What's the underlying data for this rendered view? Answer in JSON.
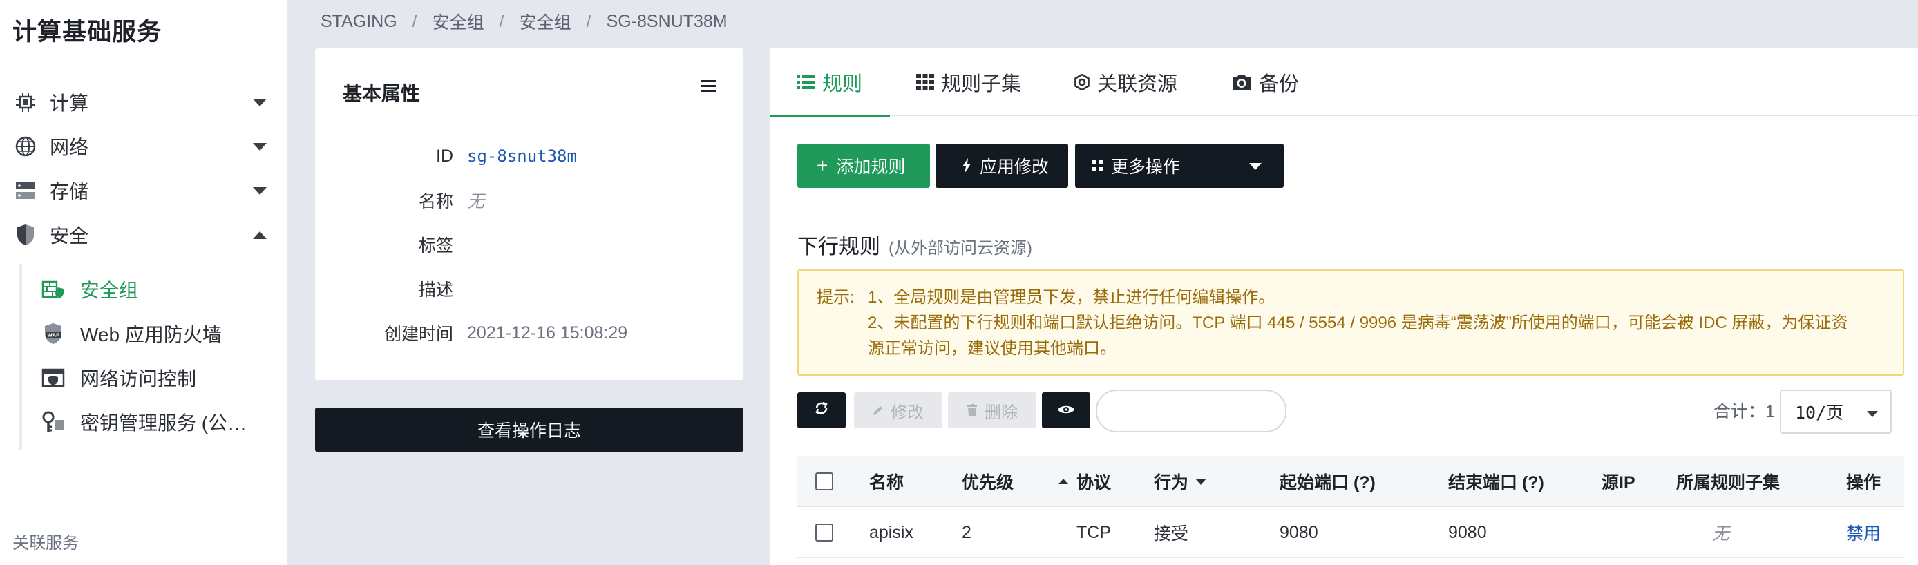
{
  "sidebar": {
    "title": "计算基础服务",
    "items": [
      {
        "label": "计算"
      },
      {
        "label": "网络"
      },
      {
        "label": "存储"
      },
      {
        "label": "安全"
      }
    ],
    "security_sub": [
      {
        "label": "安全组"
      },
      {
        "label": "Web 应用防火墙"
      },
      {
        "label": "网络访问控制"
      },
      {
        "label": "密钥管理服务 (公…"
      }
    ],
    "footer": "关联服务"
  },
  "breadcrumb": [
    "STAGING",
    "安全组",
    "安全组",
    "SG-8SNUT38M"
  ],
  "properties": {
    "title": "基本属性",
    "rows": [
      {
        "key": "ID",
        "value": "sg-8snut38m"
      },
      {
        "key": "名称",
        "value": "无"
      },
      {
        "key": "标签",
        "value": ""
      },
      {
        "key": "描述",
        "value": ""
      },
      {
        "key": "创建时间",
        "value": "2021-12-16 15:08:29"
      }
    ],
    "log_button": "查看操作日志"
  },
  "tabs": [
    {
      "label": "规则",
      "icon": "list-icon"
    },
    {
      "label": "规则子集",
      "icon": "grid-icon"
    },
    {
      "label": "关联资源",
      "icon": "gear-icon"
    },
    {
      "label": "备份",
      "icon": "camera-icon"
    }
  ],
  "actions": {
    "add_rule": "添加规则",
    "apply": "应用修改",
    "more": "更多操作"
  },
  "section": {
    "title": "下行规则",
    "hint": "(从外部访问云资源)"
  },
  "notice": {
    "label": "提示:",
    "line1": "1、全局规则是由管理员下发，禁止进行任何编辑操作。",
    "line2": "2、未配置的下行规则和端口默认拒绝访问。TCP 端口 445 / 5554 / 9996 是病毒“震荡波”所使用的端口，可能会被 IDC 屏蔽，为保证资",
    "line3": "源正常访问，建议使用其他端口。"
  },
  "toolbar": {
    "edit": "修改",
    "delete": "删除",
    "search_placeholder": "",
    "total": "合计：1",
    "page_size": "10/页"
  },
  "table": {
    "headers": [
      "名称",
      "优先级",
      "协议",
      "行为",
      "起始端口 (?)",
      "结束端口 (?)",
      "源IP",
      "所属规则子集",
      "操作"
    ],
    "rows": [
      {
        "name": "apisix",
        "priority": "2",
        "protocol": "TCP",
        "action": "接受",
        "start_port": "9080",
        "end_port": "9080",
        "source_ip": "",
        "subset": "无",
        "op": "禁用"
      }
    ]
  },
  "colors": {
    "accent": "#1f9a5a",
    "dark": "#141a21",
    "link": "#1b57b5",
    "notice_bg": "#fffbea",
    "notice_border": "#f1d77a"
  }
}
